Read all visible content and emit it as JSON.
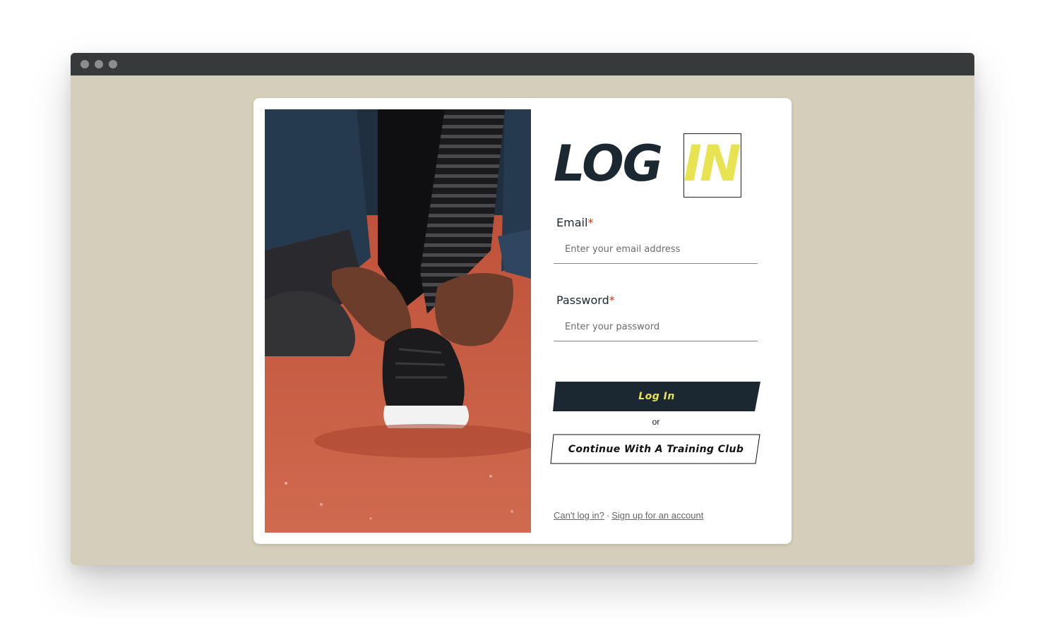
{
  "form": {
    "title_part1": "LOG",
    "title_part2": "IN",
    "email_label": "Email",
    "email_required": "*",
    "email_placeholder": "Enter your email address",
    "email_value": "",
    "password_label": "Password",
    "password_required": "*",
    "password_placeholder": "Enter your password",
    "password_value": "",
    "login_button": "Log In",
    "or_text": "or",
    "club_button": "Continue With A Training Club",
    "cant_login_link": "Can't log in?",
    "separator": "·",
    "signup_link": "Sign up for an account"
  },
  "colors": {
    "background": "#d5ceba",
    "brand_dark": "#1b2832",
    "accent_yellow": "#e8e451",
    "required_red": "#c23a1c",
    "track_orange": "#c4563c"
  },
  "image": {
    "subject": "runner-tying-shoe-photo"
  }
}
